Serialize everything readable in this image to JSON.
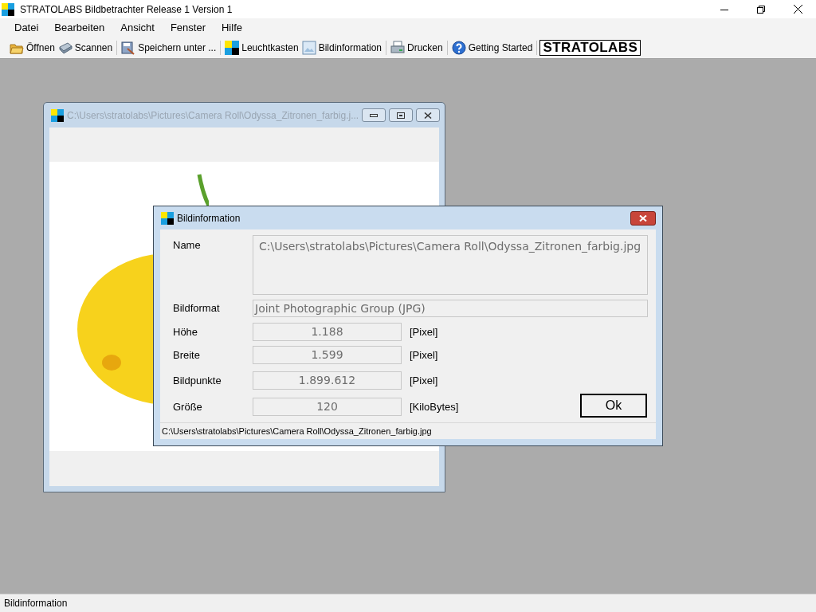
{
  "window": {
    "title": "STRATOLABS Bildbetrachter Release 1 Version 1"
  },
  "menu": [
    "Datei",
    "Bearbeiten",
    "Ansicht",
    "Fenster",
    "Hilfe"
  ],
  "toolbar": {
    "groups": [
      [
        "Öffnen",
        "Scannen"
      ],
      [
        "Speichern unter ..."
      ],
      [
        "Leuchtkasten",
        "Bildinformation"
      ],
      [
        "Drucken"
      ],
      [
        "Getting Started"
      ]
    ],
    "logo": "STRATOLABS"
  },
  "child_window": {
    "title": "C:\\Users\\stratolabs\\Pictures\\Camera Roll\\Odyssa_Zitronen_farbig.j..."
  },
  "dialog": {
    "title": "Bildinformation",
    "fields": [
      {
        "kind": "multiline",
        "label": "Name",
        "value": "C:\\Users\\stratolabs\\Pictures\\Camera Roll\\Odyssa_Zitronen_farbig.jpg"
      },
      {
        "kind": "wide",
        "label": "Bildformat",
        "value": "Joint Photographic Group (JPG)"
      },
      {
        "kind": "number",
        "label": "Höhe",
        "value": "1.188",
        "unit": "[Pixel]"
      },
      {
        "kind": "number",
        "label": "Breite",
        "value": "1.599",
        "unit": "[Pixel]"
      },
      {
        "kind": "number",
        "label": "Bildpunkte",
        "value": "1.899.612",
        "unit": "[Pixel]"
      },
      {
        "kind": "number",
        "label": "Größe",
        "value": "120",
        "unit": "[KiloBytes]"
      }
    ],
    "ok_button": "Ok",
    "status": "C:\\Users\\stratolabs\\Pictures\\Camera Roll\\Odyssa_Zitronen_farbig.jpg"
  },
  "status_bar": "Bildinformation"
}
